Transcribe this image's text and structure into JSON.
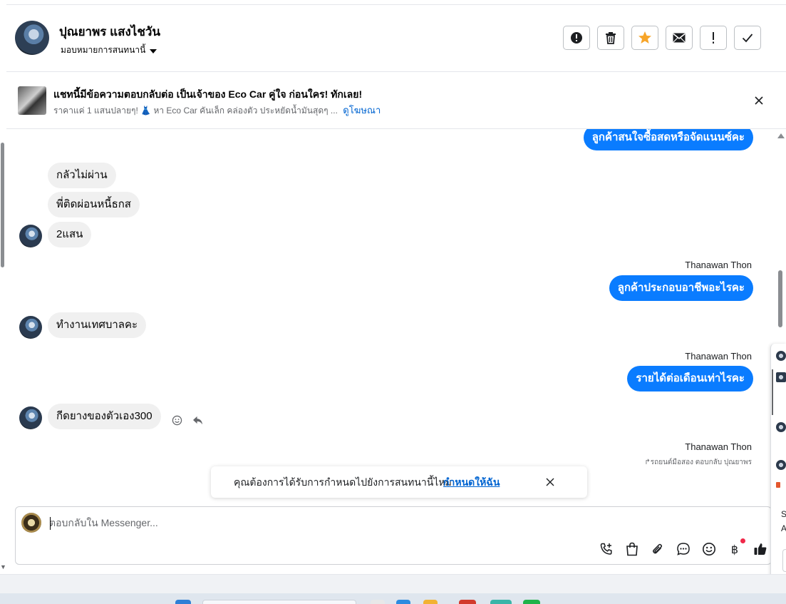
{
  "header": {
    "contact_name": "ปุณยาพร แสงไชวัน",
    "assign_label": "มอบหมายการสนทนานี้",
    "buttons": [
      {
        "name": "report-spam-button",
        "icon": "exclamation-circle-icon"
      },
      {
        "name": "delete-button",
        "icon": "trash-icon"
      },
      {
        "name": "star-button",
        "icon": "star-icon",
        "color": "#f7a529"
      },
      {
        "name": "mark-unread-button",
        "icon": "envelope-icon"
      },
      {
        "name": "follow-up-button",
        "icon": "exclamation-icon"
      },
      {
        "name": "mark-done-button",
        "icon": "check-icon"
      }
    ]
  },
  "ad": {
    "title": "แชทนี้มีข้อความตอบกลับต่อ เป็นเจ้าของ Eco Car คู่ใจ ก่อนใคร! ทักเลย!",
    "subtitle": "ราคาแค่ 1 แสนปลายๆ! 👗 หา Eco Car คันเล็ก คล่องตัว ประหยัดน้ำมันสุดๆ ...",
    "link": "ดูโฆษณา"
  },
  "messages": [
    {
      "dir": "out",
      "text": "ลูกค้าสนใจซื้อสดหรือจัดแนนซ์คะ"
    },
    {
      "dir": "in",
      "text": "กลัวไม่ผ่าน"
    },
    {
      "dir": "in",
      "text": "พี่ติดผ่อนหนี้ธกส"
    },
    {
      "dir": "in",
      "text": "2แสน"
    },
    {
      "dir": "out",
      "sender": "Thanawan Thon",
      "text": "ลูกค้าประกอบอาชีพอะไรคะ"
    },
    {
      "dir": "in",
      "text": "ทำงานเทศบาลคะ"
    },
    {
      "dir": "out",
      "sender": "Thanawan Thon",
      "text": "รายได้ต่อเดือนเท่าไรคะ"
    },
    {
      "dir": "in",
      "text": "กีดยางของตัวเอง300"
    },
    {
      "dir": "out",
      "sender": "Thanawan Thon",
      "reply_note": "รถยนต์มือสอง ตอบกลับ ปุณยาพร"
    }
  ],
  "toast": {
    "text": "คุณต้องการได้รับการกำหนดไปยังการสนทนานี้ไหม",
    "link": "กำหนดให้ฉัน"
  },
  "composer": {
    "placeholder": "ตอบกลับใน Messenger...",
    "tools": [
      "phone-plus-icon",
      "shopping-bag-icon",
      "paperclip-icon",
      "chat-bubble-icon",
      "emoji-icon",
      "baht-icon",
      "thumbs-up-icon"
    ]
  },
  "side_panel": {
    "letters": [
      "S",
      "A"
    ]
  },
  "colors": {
    "outgoing_bubble": "#0a7cff",
    "incoming_bubble": "#f0f0f0",
    "link": "#0064d1"
  }
}
